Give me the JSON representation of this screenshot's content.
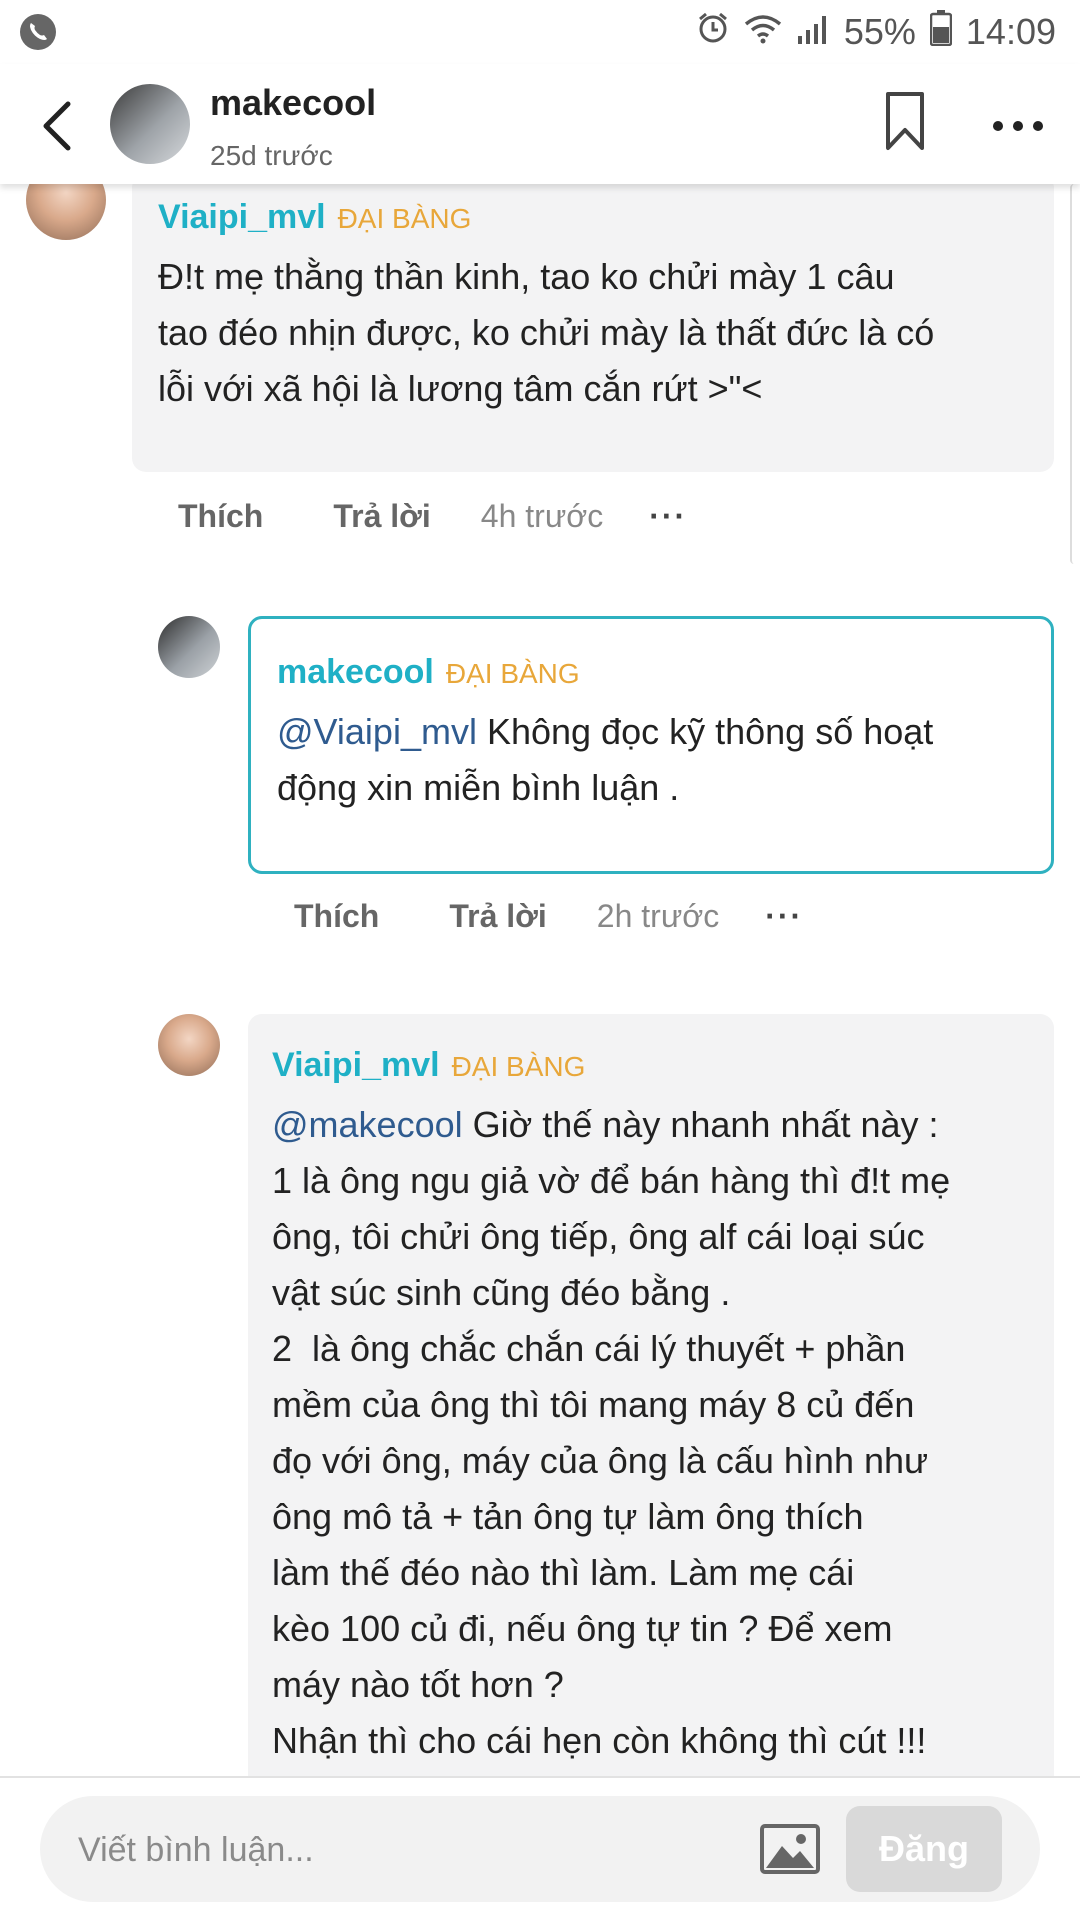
{
  "status_bar": {
    "battery": "55%",
    "time": "14:09",
    "icons": [
      "phone-icon",
      "alarm-icon",
      "wifi-icon",
      "signal-icon",
      "battery-icon"
    ]
  },
  "header": {
    "username": "makecool",
    "time": "25d trước"
  },
  "comments": [
    {
      "username": "Viaipi_mvl",
      "rank": "ĐẠI BÀNG",
      "mention": "",
      "text": "Đ!t mẹ thằng thần kinh, tao ko chửi mày 1 câu\ntao đéo nhịn được, ko chửi mày là thất đức là có\nlỗi với xã hội là lương tâm cắn rứt >\"<",
      "like": "Thích",
      "reply": "Trả lời",
      "time": "4h trước",
      "more": "···"
    },
    {
      "username": "makecool",
      "rank": "ĐẠI BÀNG",
      "mention": "@Viaipi_mvl",
      "text": " Không đọc kỹ thông số hoạt\nđộng xin miễn bình luận .",
      "like": "Thích",
      "reply": "Trả lời",
      "time": "2h trước",
      "more": "···"
    },
    {
      "username": "Viaipi_mvl",
      "rank": "ĐẠI BÀNG",
      "mention": "@makecool",
      "text": " Giờ thế này nhanh nhất này :\n1 là ông ngu giả vờ để bán hàng thì đ!t mẹ\nông, tôi chửi ông tiếp, ông alf cái loại súc\nvật súc sinh cũng đéo bằng .\n2  là ông chắc chắn cái lý thuyết + phần\nmềm của ông thì tôi mang máy 8 củ đến\nđọ với ông, máy của ông là cấu hình như\nông mô tả + tản ông tự làm ông thích\nlàm thế đéo nào thì làm. Làm mẹ cái\nkèo 100 củ đi, nếu ông tự tin ? Để xem\nmáy nào tốt hơn ?\nNhận thì cho cái hẹn còn không thì cút !!!"
    }
  ],
  "composer": {
    "placeholder": "Viết bình luận...",
    "post_label": "Đăng"
  }
}
